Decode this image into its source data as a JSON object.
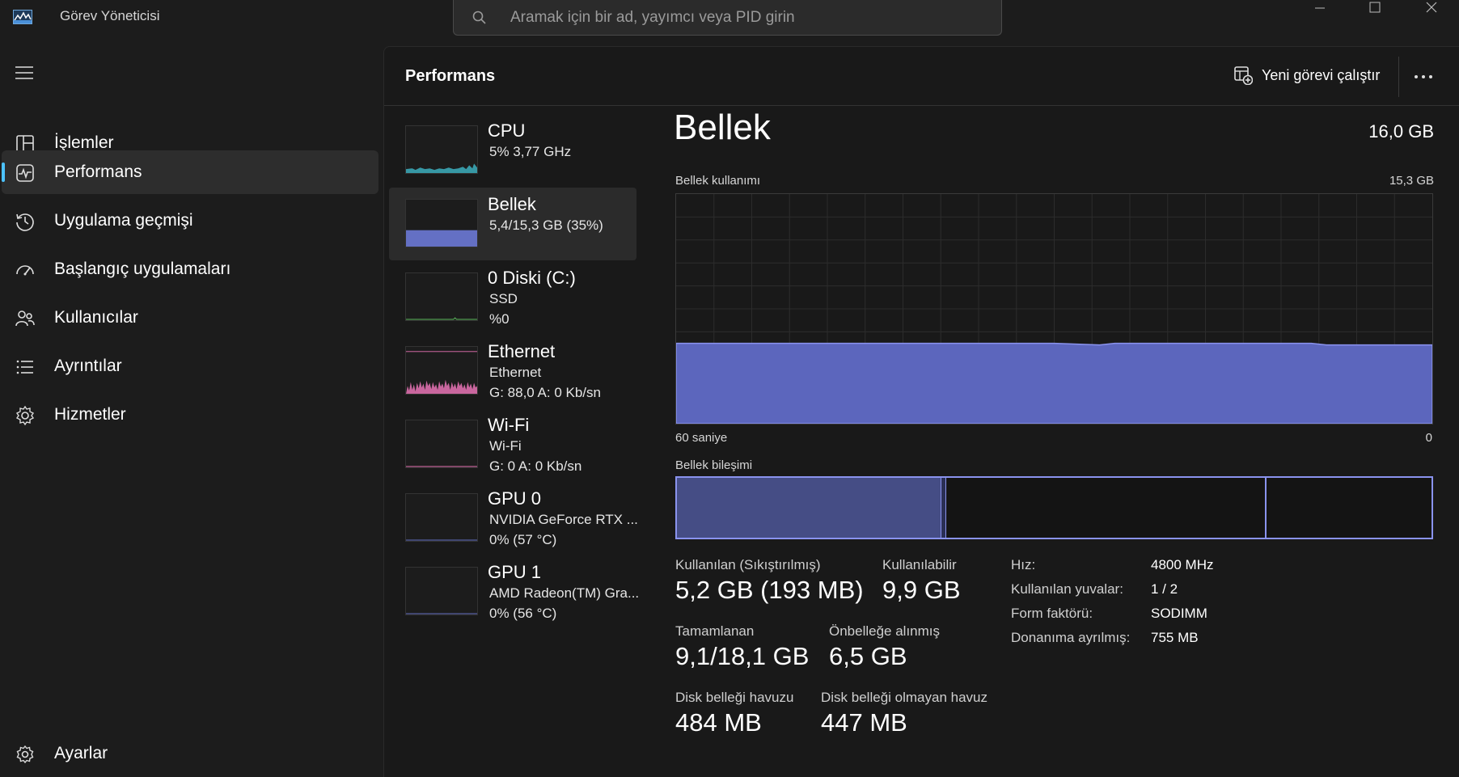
{
  "window": {
    "title": "Görev Yöneticisi",
    "search_placeholder": "Aramak için bir ad, yayımcı veya PID girin"
  },
  "sidebar": {
    "items": [
      {
        "label": "İşlemler",
        "icon": "processes-icon",
        "active": false
      },
      {
        "label": "Performans",
        "icon": "performance-icon",
        "active": true
      },
      {
        "label": "Uygulama geçmişi",
        "icon": "history-icon",
        "active": false
      },
      {
        "label": "Başlangıç uygulamaları",
        "icon": "startup-icon",
        "active": false
      },
      {
        "label": "Kullanıcılar",
        "icon": "users-icon",
        "active": false
      },
      {
        "label": "Ayrıntılar",
        "icon": "details-icon",
        "active": false
      },
      {
        "label": "Hizmetler",
        "icon": "services-icon",
        "active": false
      }
    ],
    "settings_label": "Ayarlar"
  },
  "header": {
    "title": "Performans",
    "run_task_label": "Yeni görevi çalıştır"
  },
  "devices": [
    {
      "name": "CPU",
      "line1": "5%  3,77 GHz",
      "line2": ""
    },
    {
      "name": "Bellek",
      "line1": "5,4/15,3 GB (35%)",
      "line2": ""
    },
    {
      "name": "0 Diski (C:)",
      "line1": "SSD",
      "line2": "%0"
    },
    {
      "name": "Ethernet",
      "line1": "Ethernet",
      "line2": "G: 88,0  A: 0 Kb/sn"
    },
    {
      "name": "Wi-Fi",
      "line1": "Wi-Fi",
      "line2": "G: 0  A: 0 Kb/sn"
    },
    {
      "name": "GPU 0",
      "line1": "NVIDIA GeForce RTX ...",
      "line2": "0%  (57 °C)"
    },
    {
      "name": "GPU 1",
      "line1": "AMD Radeon(TM) Gra...",
      "line2": "0%  (56 °C)"
    }
  ],
  "detail": {
    "title": "Bellek",
    "total": "16,0 GB",
    "usage_label": "Bellek kullanımı",
    "usage_max": "15,3 GB",
    "time_left": "60 saniye",
    "time_right": "0",
    "usage_fraction": 0.35,
    "composition_label": "Bellek bileşimi",
    "stats": {
      "in_use_label": "Kullanılan (Sıkıştırılmış)",
      "in_use_value": "5,2 GB (193 MB)",
      "available_label": "Kullanılabilir",
      "available_value": "9,9 GB",
      "committed_label": "Tamamlanan",
      "committed_value": "9,1/18,1 GB",
      "cached_label": "Önbelleğe alınmış",
      "cached_value": "6,5 GB",
      "paged_label": "Disk belleği havuzu",
      "paged_value": "484 MB",
      "nonpaged_label": "Disk belleği olmayan havuz",
      "nonpaged_value": "447 MB"
    },
    "specs": [
      {
        "key": "Hız:",
        "value": "4800 MHz"
      },
      {
        "key": "Kullanılan yuvalar:",
        "value": "1 / 2"
      },
      {
        "key": "Form faktörü:",
        "value": "SODIMM"
      },
      {
        "key": "Donanıma ayrılmış:",
        "value": "755 MB"
      }
    ]
  },
  "colors": {
    "accent": "#4cc2ff",
    "memory": "#6470c4",
    "cpu": "#3fb8c8",
    "ethernet": "#e873b5"
  }
}
